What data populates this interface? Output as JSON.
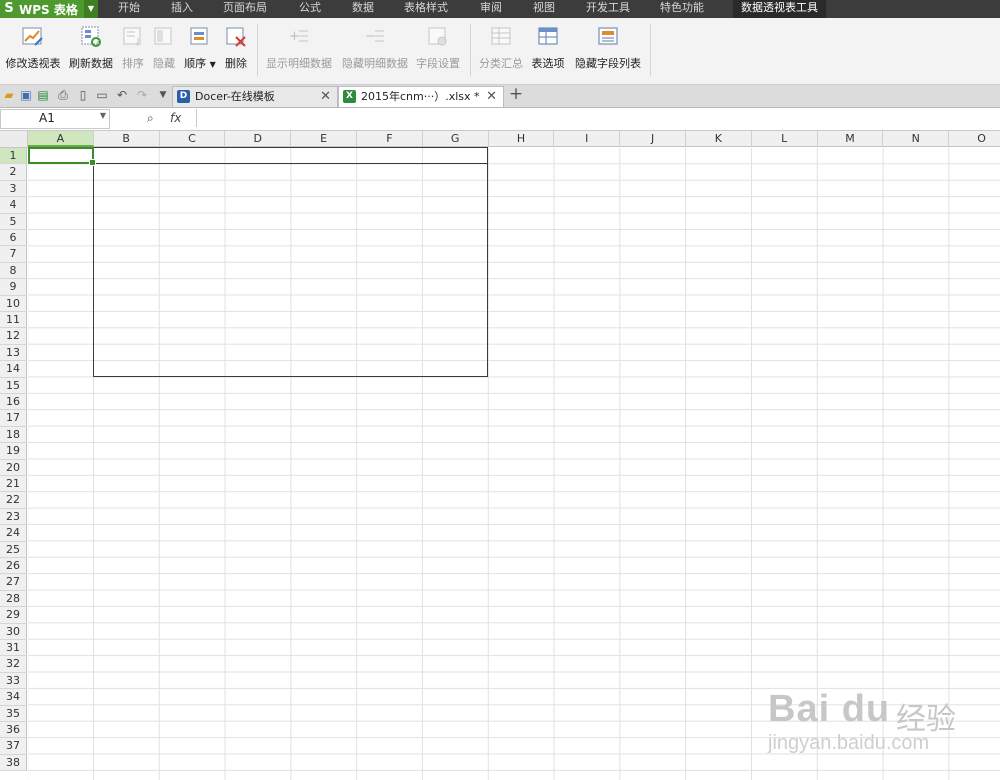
{
  "menubar": {
    "app_name": "WPS 表格",
    "items": [
      "开始",
      "插入",
      "页面布局",
      "公式",
      "数据",
      "表格样式",
      "审阅",
      "视图",
      "开发工具",
      "特色功能",
      "数据透视表工具"
    ]
  },
  "ribbon": {
    "buttons": [
      {
        "label": "修改透视表",
        "icon": "edit-pivot-icon",
        "enabled": true
      },
      {
        "label": "刷新数据",
        "icon": "refresh-data-icon",
        "enabled": true
      },
      {
        "label": "排序",
        "icon": "sort-icon",
        "enabled": false
      },
      {
        "label": "隐藏",
        "icon": "hide-icon",
        "enabled": false
      },
      {
        "label": "顺序",
        "icon": "order-icon",
        "enabled": true
      },
      {
        "label": "删除",
        "icon": "delete-icon",
        "enabled": true
      },
      {
        "label": "显示明细数据",
        "icon": "show-detail-icon",
        "enabled": false
      },
      {
        "label": "隐藏明细数据",
        "icon": "hide-detail-icon",
        "enabled": false
      },
      {
        "label": "字段设置",
        "icon": "field-settings-icon",
        "enabled": false
      },
      {
        "label": "分类汇总",
        "icon": "subtotal-icon",
        "enabled": false
      },
      {
        "label": "表选项",
        "icon": "table-options-icon",
        "enabled": true
      },
      {
        "label": "隐藏字段列表",
        "icon": "field-list-icon",
        "enabled": true
      }
    ]
  },
  "tabs": [
    {
      "label": "Docer-在线模板",
      "active": false
    },
    {
      "label": "2015年cnm···）.xlsx *",
      "active": true
    }
  ],
  "formula_bar": {
    "name_box": "A1",
    "fx": "fx",
    "formula": ""
  },
  "grid": {
    "columns": [
      "A",
      "B",
      "C",
      "D",
      "E",
      "F",
      "G",
      "H",
      "I",
      "J",
      "K",
      "L",
      "M",
      "N",
      "O"
    ],
    "rows": [
      "1",
      "2",
      "3",
      "4",
      "5",
      "6",
      "7",
      "8",
      "9",
      "10",
      "11",
      "12",
      "13",
      "14",
      "15",
      "16",
      "17",
      "18",
      "19",
      "20",
      "21",
      "22",
      "23",
      "24",
      "25",
      "26",
      "27",
      "28",
      "29",
      "30",
      "31",
      "32",
      "33",
      "34",
      "35",
      "36",
      "37",
      "38"
    ],
    "selected_cell": "A1"
  },
  "watermark": {
    "logo": "Bai du",
    "cn": "经验",
    "url": "jingyan.baidu.com"
  },
  "colors": {
    "app_green": "#4f9a2e",
    "accent_pink": "#d54fa7",
    "selection_green": "#3d8c2a"
  }
}
